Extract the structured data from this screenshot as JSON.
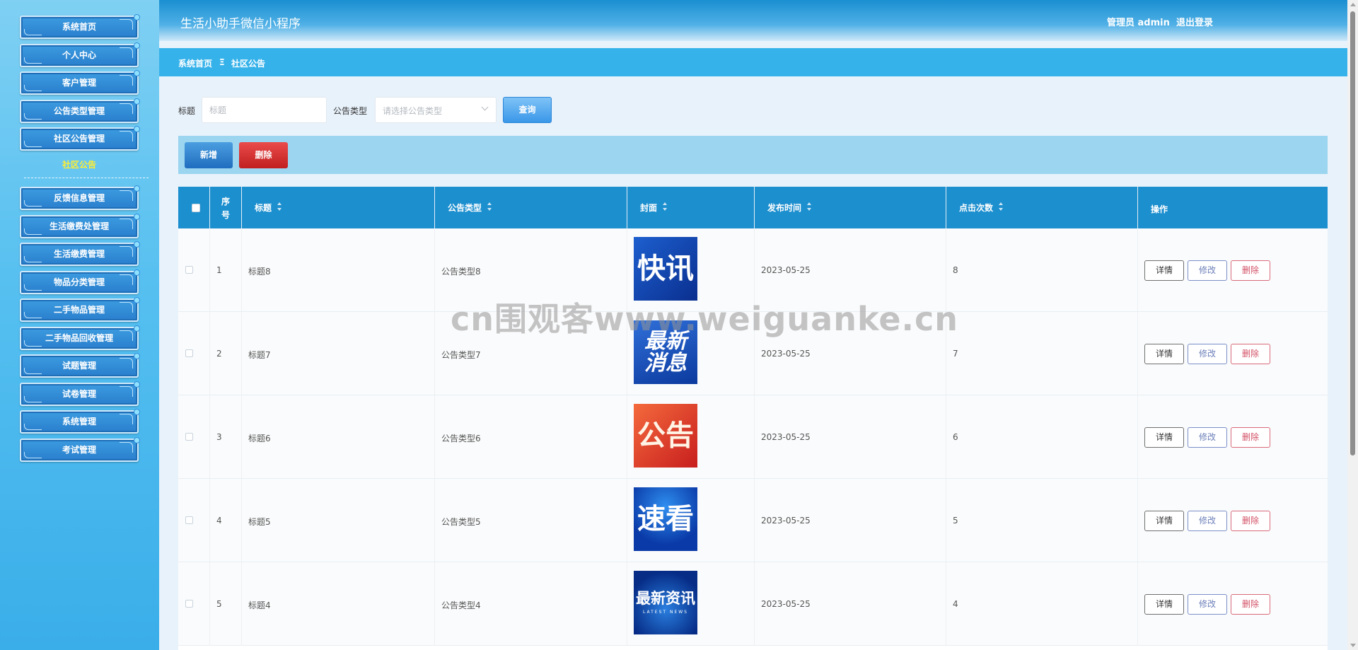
{
  "sidebar": {
    "items": [
      {
        "label": "系统首页"
      },
      {
        "label": "个人中心"
      },
      {
        "label": "客户管理"
      },
      {
        "label": "公告类型管理"
      },
      {
        "label": "社区公告管理"
      },
      {
        "label": "反馈信息管理"
      },
      {
        "label": "生活缴费处管理"
      },
      {
        "label": "生活缴费管理"
      },
      {
        "label": "物品分类管理"
      },
      {
        "label": "二手物品管理"
      },
      {
        "label": "二手物品回收管理"
      },
      {
        "label": "试题管理"
      },
      {
        "label": "试卷管理"
      },
      {
        "label": "系统管理"
      },
      {
        "label": "考试管理"
      }
    ],
    "active_submenu": "社区公告"
  },
  "header": {
    "title": "生活小助手微信小程序",
    "user": "管理员 admin",
    "logout": "退出登录"
  },
  "breadcrumb": {
    "home": "系统首页",
    "separator": "Ξ",
    "current": "社区公告"
  },
  "search": {
    "title_label": "标题",
    "title_placeholder": "标题",
    "type_label": "公告类型",
    "type_placeholder": "请选择公告类型",
    "query_button": "查询"
  },
  "toolbar": {
    "add_button": "新增",
    "delete_button": "删除"
  },
  "table": {
    "columns": {
      "index": "序号",
      "title": "标题",
      "type": "公告类型",
      "cover": "封面",
      "publish_time": "发布时间",
      "clicks": "点击次数",
      "actions": "操作"
    },
    "action_labels": {
      "detail": "详情",
      "edit": "修改",
      "delete": "删除"
    },
    "rows": [
      {
        "index": "1",
        "title": "标题8",
        "type": "公告类型8",
        "cover_text": "快讯",
        "publish_time": "2023-05-25",
        "clicks": "8"
      },
      {
        "index": "2",
        "title": "标题7",
        "type": "公告类型7",
        "cover_text": "最新消息",
        "publish_time": "2023-05-25",
        "clicks": "7"
      },
      {
        "index": "3",
        "title": "标题6",
        "type": "公告类型6",
        "cover_text": "公告",
        "publish_time": "2023-05-25",
        "clicks": "6"
      },
      {
        "index": "4",
        "title": "标题5",
        "type": "公告类型5",
        "cover_text": "速看",
        "publish_time": "2023-05-25",
        "clicks": "5"
      },
      {
        "index": "5",
        "title": "标题4",
        "type": "公告类型4",
        "cover_text": "最新资讯",
        "cover_subtext": "LATEST NEWS",
        "publish_time": "2023-05-25",
        "clicks": "4"
      }
    ]
  },
  "watermark": "cn围观客www.weiguanke.cn",
  "colors": {
    "header": "#1a8fd1",
    "breadcrumb": "#36b2ea",
    "table_header": "#1c8fcf",
    "add_button": "#1f6dbf",
    "delete_button": "#c11f1f",
    "submenu_active": "#ffee33"
  }
}
